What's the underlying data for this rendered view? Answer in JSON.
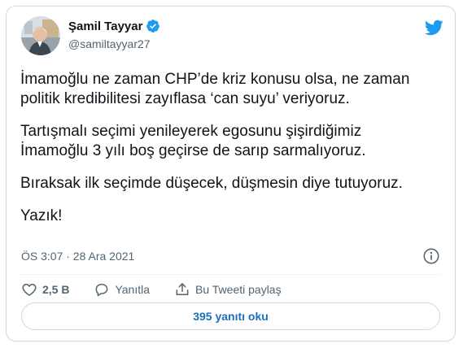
{
  "author": {
    "name": "Şamil Tayyar",
    "handle": "@samiltayyar27"
  },
  "tweet": {
    "paragraphs": [
      "İmamoğlu ne zaman CHP’de kriz konusu olsa, ne zaman",
      "politik kredibilitesi zayıflasa ‘can suyu’ veriyoruz.",
      "Tartışmalı seçimi yenileyerek egosunu şişirdiğimiz",
      "İmamoğlu 3 yılı boş geçirse de sarıp sarmalıyoruz.",
      "Bıraksak ilk seçimde düşecek, düşmesin diye tutuyoruz.",
      "Yazık!"
    ],
    "timestamp": "ÖS 3:07 · 28 Ara 2021"
  },
  "actions": {
    "like_count": "2,5 B",
    "reply_label": "Yanıtla",
    "share_label": "Bu Tweeti paylaş"
  },
  "replies_button": "395 yanıtı oku",
  "colors": {
    "accent": "#1d9bf0",
    "link_text": "#1d6fb8",
    "secondary_text": "#536471",
    "border": "#cfd9de"
  },
  "icons": {
    "avatar": "profile-photo",
    "verified": "verified-badge-icon",
    "brand": "twitter-bird-icon",
    "info": "info-icon",
    "like": "heart-icon",
    "reply": "speech-bubble-icon",
    "share": "share-upload-icon"
  }
}
